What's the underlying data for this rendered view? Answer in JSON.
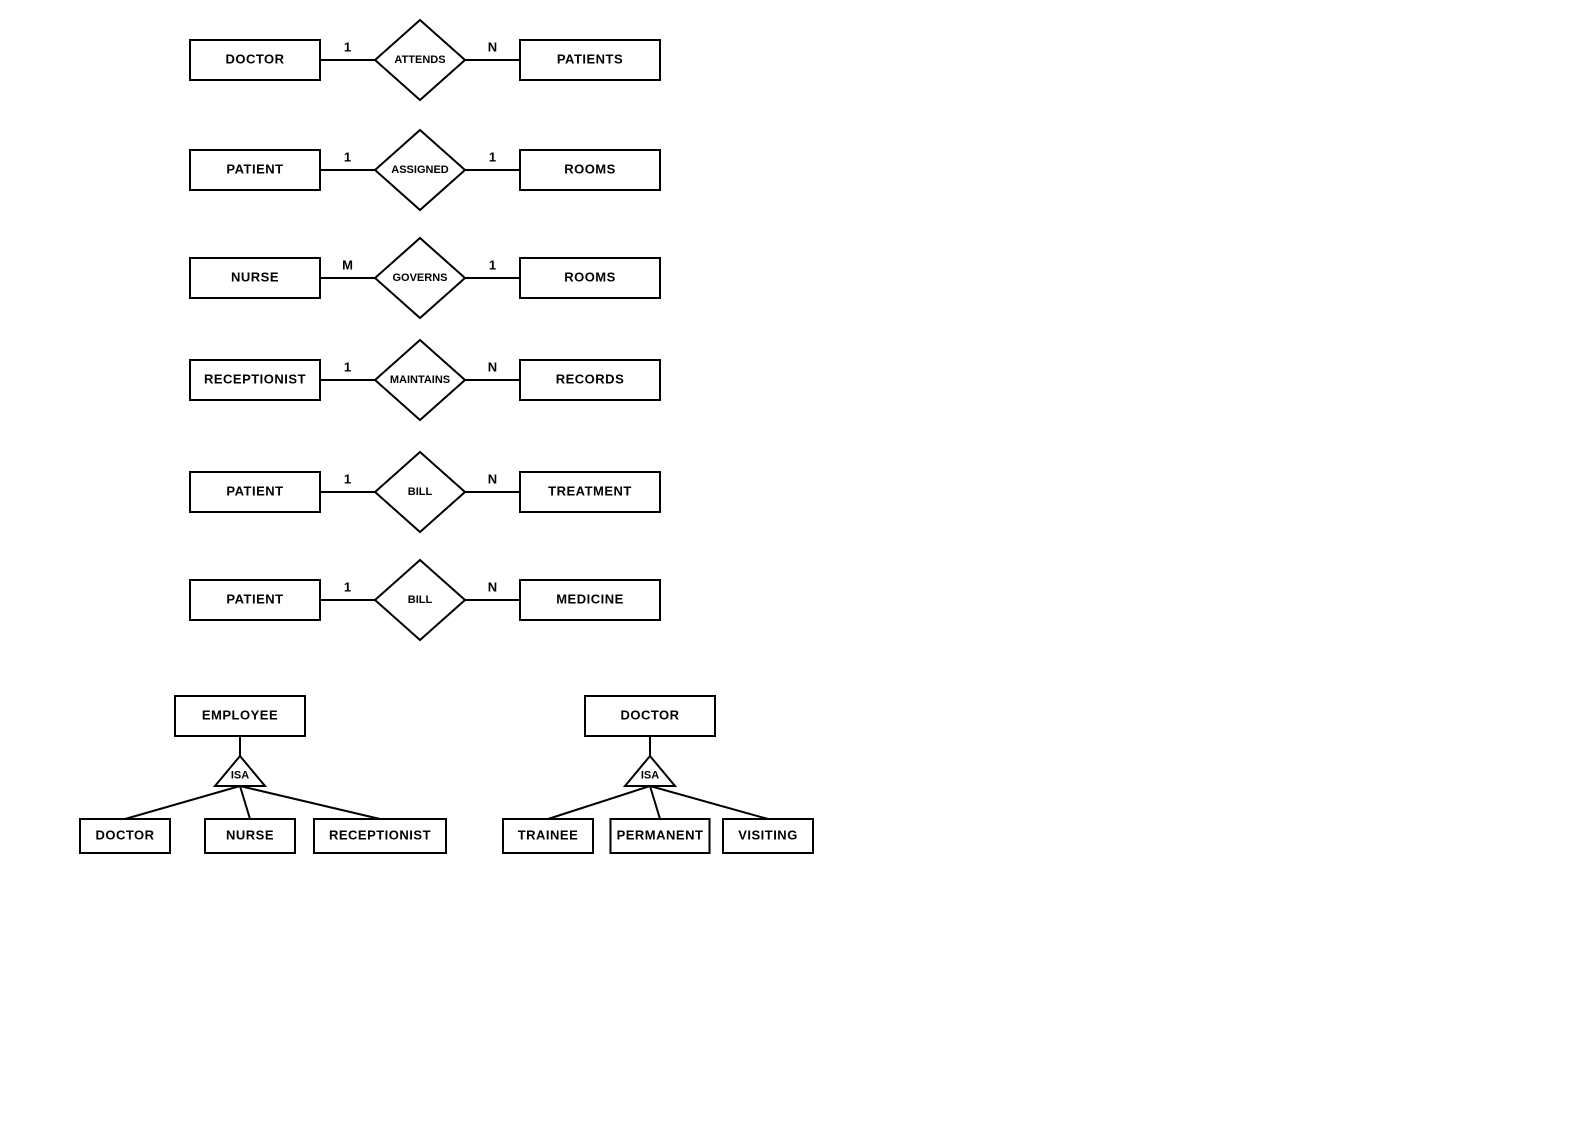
{
  "rows": [
    {
      "left": "DOCTOR",
      "rel": "ATTENDS",
      "right": "PATIENTS",
      "lcard": "1",
      "rcard": "N"
    },
    {
      "left": "PATIENT",
      "rel": "ASSIGNED",
      "right": "ROOMS",
      "lcard": "1",
      "rcard": "1"
    },
    {
      "left": "NURSE",
      "rel": "GOVERNS",
      "right": "ROOMS",
      "lcard": "M",
      "rcard": "1"
    },
    {
      "left": "RECEPTIONIST",
      "rel": "MAINTAINS",
      "right": "RECORDS",
      "lcard": "1",
      "rcard": "N"
    },
    {
      "left": "PATIENT",
      "rel": "BILL",
      "right": "TREATMENT",
      "lcard": "1",
      "rcard": "N"
    },
    {
      "left": "PATIENT",
      "rel": "BILL",
      "right": "MEDICINE",
      "lcard": "1",
      "rcard": "N"
    }
  ],
  "isa1": {
    "super": "EMPLOYEE",
    "label": "ISA",
    "subs": [
      "DOCTOR",
      "NURSE",
      "RECEPTIONIST"
    ]
  },
  "isa2": {
    "super": "DOCTOR",
    "label": "ISA",
    "subs": [
      "TRAINEE",
      "PERMANENT",
      "VISITING"
    ]
  }
}
